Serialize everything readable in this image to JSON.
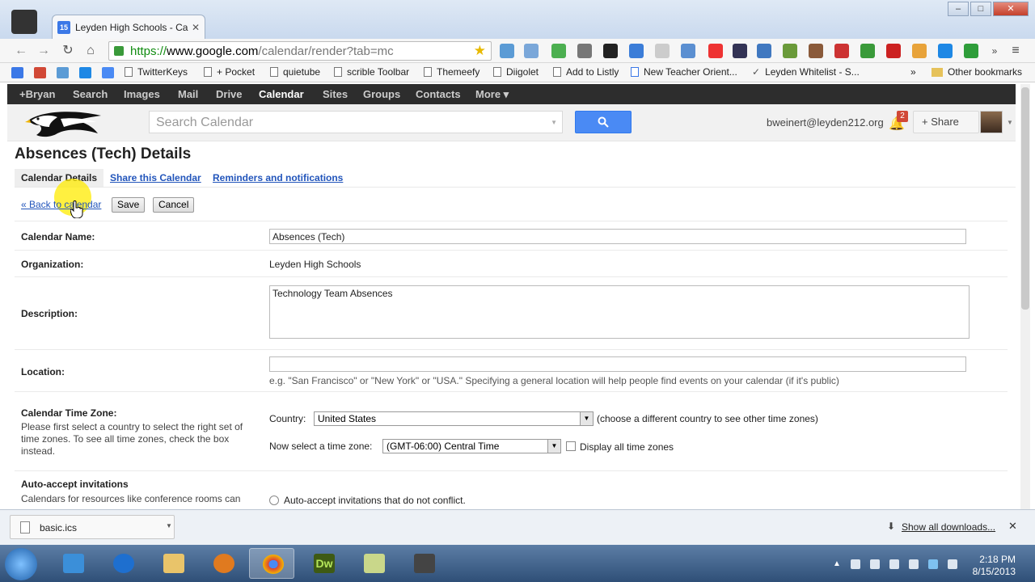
{
  "browser": {
    "tab_title": "Leyden High Schools - Ca",
    "tab_favicon": "15",
    "url_https": "https://",
    "url_host": "www.google.com",
    "url_rest": "/calendar/render?tab=mc",
    "window_controls": [
      "–",
      "□",
      "✕"
    ]
  },
  "bookmarks": {
    "items": [
      "TwitterKeys",
      "+ Pocket",
      "quietube",
      "scrible Toolbar",
      "Themeefy",
      "Diigolet",
      "Add to Listly",
      "New Teacher Orient...",
      "Leyden Whitelist - S..."
    ],
    "overflow": "»",
    "other": "Other bookmarks"
  },
  "gbar": {
    "items": [
      "+Bryan",
      "Search",
      "Images",
      "Mail",
      "Drive",
      "Calendar",
      "Sites",
      "Groups",
      "Contacts",
      "More ▾"
    ],
    "active": "Calendar"
  },
  "header": {
    "search_placeholder": "Search Calendar",
    "email": "bweinert@leyden212.org",
    "notification_count": "2",
    "share_label": "+ Share"
  },
  "page": {
    "title": "Absences (Tech) Details",
    "tabs": [
      "Calendar Details",
      "Share this Calendar",
      "Reminders and notifications"
    ],
    "back_link": "« Back to calendar",
    "save_label": "Save",
    "cancel_label": "Cancel",
    "fields": {
      "calendar_name_label": "Calendar Name:",
      "calendar_name_value": "Absences (Tech)",
      "organization_label": "Organization:",
      "organization_value": "Leyden High Schools",
      "description_label": "Description:",
      "description_value": "Technology Team Absences",
      "location_label": "Location:",
      "location_value": "",
      "location_help": "e.g. \"San Francisco\" or \"New York\" or \"USA.\" Specifying a general location will help people find events on your calendar (if it's public)",
      "timezone_label": "Calendar Time Zone:",
      "timezone_help": "Please first select a country to select the right set of time zones. To see all time zones, check the box instead.",
      "country_label": "Country:",
      "country_value": "United States",
      "country_hint": "(choose a different country to see other time zones)",
      "tz_select_label": "Now select a time zone:",
      "tz_value": "(GMT-06:00) Central Time",
      "display_all_label": "Display all time zones",
      "auto_accept_label": "Auto-accept invitations",
      "auto_accept_help": "Calendars for resources like conference rooms can",
      "auto_accept_option": "Auto-accept invitations that do not conflict."
    }
  },
  "downloads": {
    "file": "basic.ics",
    "show_all": "Show all downloads...",
    "close": "✕"
  },
  "taskbar": {
    "time": "2:18 PM",
    "date": "8/15/2013",
    "dw_label": "Dw"
  },
  "colors": {
    "link": "#2255bb",
    "gbar_bg": "#2d2d2d",
    "search_button": "#4a8af4",
    "badge": "#d14836"
  }
}
